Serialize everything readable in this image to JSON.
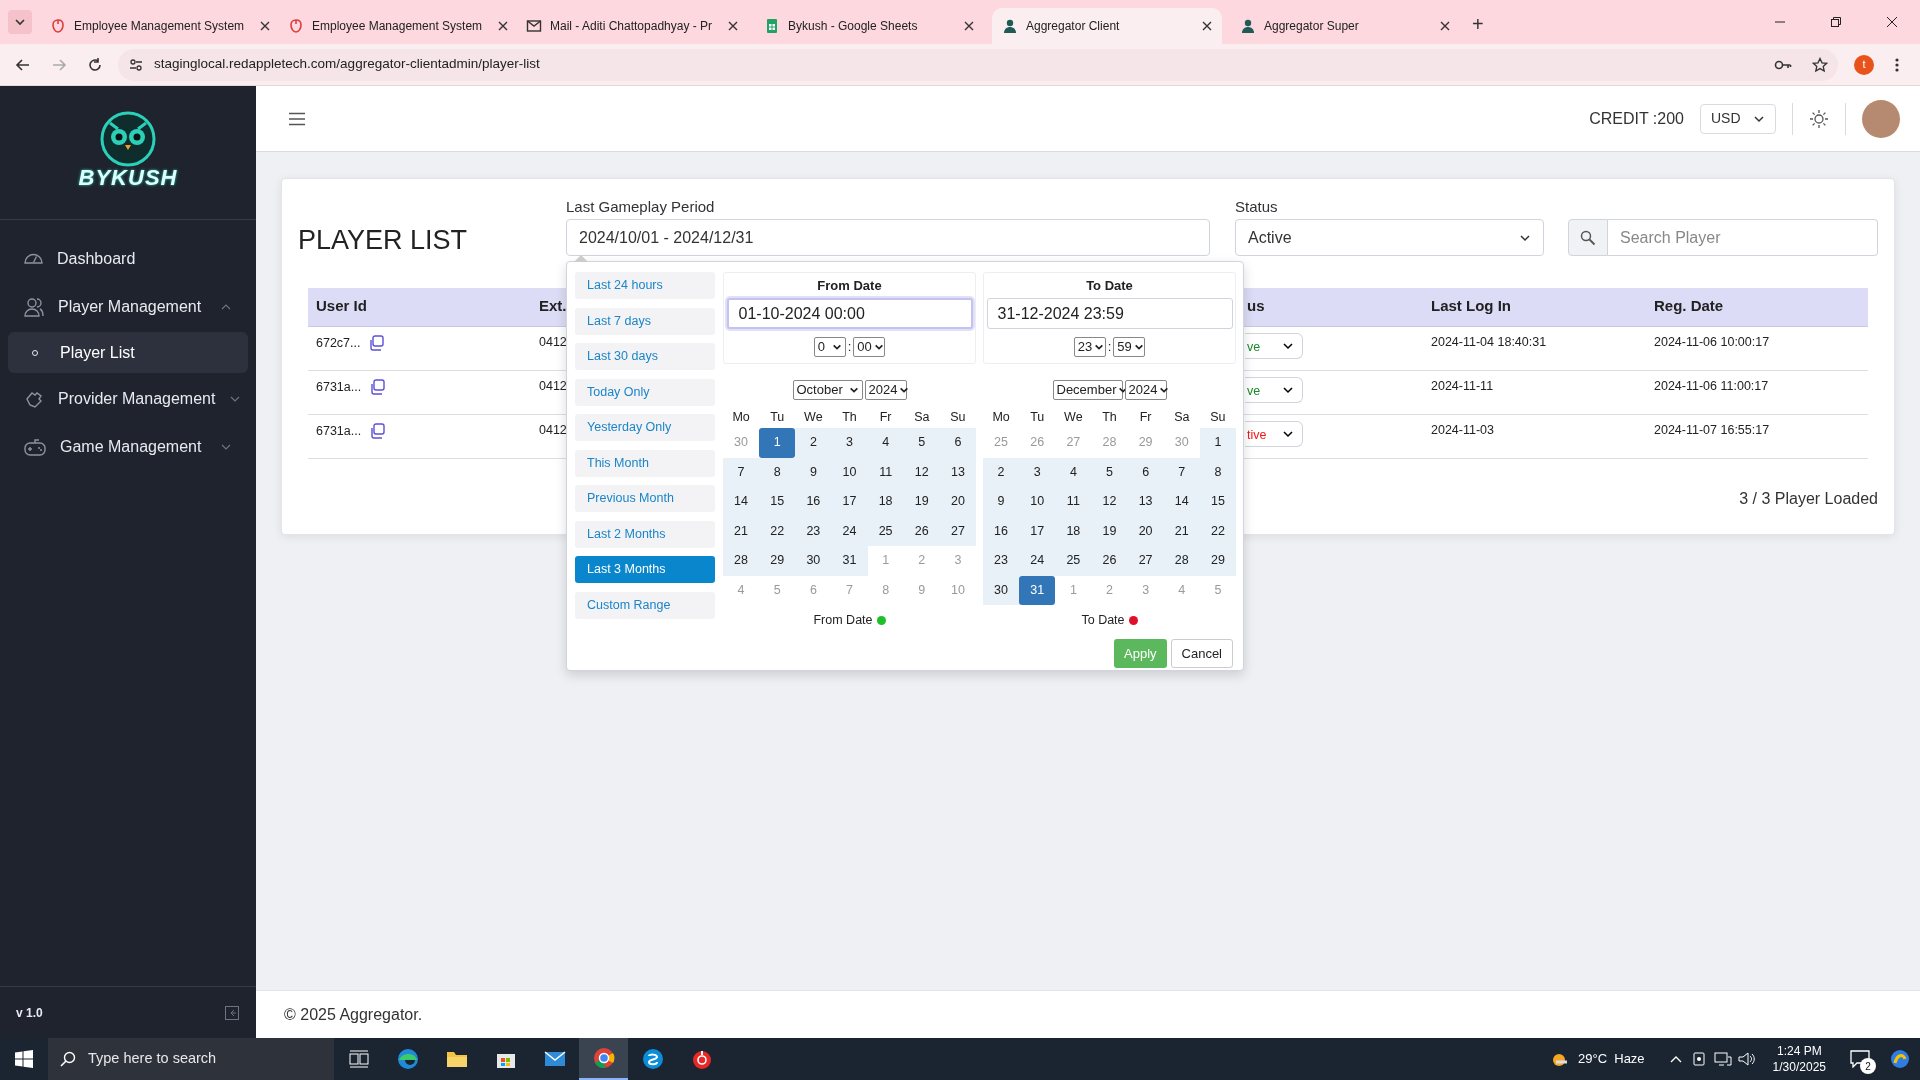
{
  "browser": {
    "tabs": [
      {
        "title": "Employee Management System",
        "selected": false
      },
      {
        "title": "Employee Management System",
        "selected": false
      },
      {
        "title": "Mail - Aditi Chattopadhyay - Pr",
        "selected": false
      },
      {
        "title": "Bykush - Google Sheets",
        "selected": false
      },
      {
        "title": "Aggregator Client",
        "selected": true
      },
      {
        "title": "Aggregator Super",
        "selected": false
      }
    ],
    "new_tab": "+",
    "address": "staginglocal.redappletech.com/aggregator-clientadmin/player-list",
    "profile_initial": "t"
  },
  "sidebar": {
    "logo_text": "BYKUSH",
    "items": [
      {
        "label": "Dashboard",
        "kind": "link"
      },
      {
        "label": "Player Management",
        "kind": "group",
        "expanded": true,
        "children": [
          {
            "label": "Player List",
            "selected": true
          }
        ]
      },
      {
        "label": "Provider Management",
        "kind": "group",
        "expanded": false
      },
      {
        "label": "Game Management",
        "kind": "group",
        "expanded": false
      }
    ],
    "version": "v 1.0"
  },
  "header": {
    "credit": "CREDIT :200",
    "currency": "USD"
  },
  "page": {
    "title": "PLAYER LIST",
    "period": {
      "label": "Last Gameplay Period",
      "value": "2024/10/01 - 2024/12/31"
    },
    "status": {
      "label": "Status",
      "value": "Active"
    },
    "search": {
      "placeholder": "Search Player"
    },
    "table": {
      "columns": [
        "User Id",
        "Ext.",
        "us",
        "Last Log In",
        "Reg. Date"
      ],
      "rows": [
        {
          "user_id": "672c7...",
          "ext": "0412",
          "status": "ve",
          "color": "#1e8a2e",
          "last_login": "2024-11-04 18:40:31",
          "reg_date": "2024-11-06 10:00:17"
        },
        {
          "user_id": "6731a...",
          "ext": "0412",
          "status": "ve",
          "color": "#1e8a2e",
          "last_login": "2024-11-11",
          "reg_date": "2024-11-06 11:00:17"
        },
        {
          "user_id": "6731a...",
          "ext": "0412",
          "status": "tive",
          "color": "#f01818",
          "last_login": "2024-11-03",
          "reg_date": "2024-11-07 16:55:17"
        }
      ]
    },
    "loaded": "3 / 3 Player Loaded"
  },
  "date_picker": {
    "ranges": [
      {
        "label": "Last 24 hours",
        "selected": false
      },
      {
        "label": "Last 7 days",
        "selected": false
      },
      {
        "label": "Last 30 days",
        "selected": false
      },
      {
        "label": "Today Only",
        "selected": false
      },
      {
        "label": "Yesterday Only",
        "selected": false
      },
      {
        "label": "This Month",
        "selected": false
      },
      {
        "label": "Previous Month",
        "selected": false
      },
      {
        "label": "Last 2 Months",
        "selected": false
      },
      {
        "label": "Last 3 Months",
        "selected": true
      },
      {
        "label": "Custom Range",
        "selected": false
      }
    ],
    "calendars": [
      {
        "title": "From Date",
        "value": "01-10-2024 00:00",
        "focused": true,
        "hour": "0",
        "time_separator": ":",
        "minute": "00",
        "month": "October",
        "year": "2024",
        "legend": "From Date",
        "color": "#1fbf2a",
        "weekdays": [
          "Mo",
          "Tu",
          "We",
          "Th",
          "Fr",
          "Sa",
          "Su"
        ],
        "days": [
          {
            "d": "30",
            "kind": "other"
          },
          {
            "d": "1",
            "kind": "selected"
          },
          {
            "d": "2",
            "kind": "range"
          },
          {
            "d": "3",
            "kind": "range"
          },
          {
            "d": "4",
            "kind": "range"
          },
          {
            "d": "5",
            "kind": "range"
          },
          {
            "d": "6",
            "kind": "range"
          },
          {
            "d": "7",
            "kind": "range"
          },
          {
            "d": "8",
            "kind": "range"
          },
          {
            "d": "9",
            "kind": "range"
          },
          {
            "d": "10",
            "kind": "range"
          },
          {
            "d": "11",
            "kind": "range"
          },
          {
            "d": "12",
            "kind": "range"
          },
          {
            "d": "13",
            "kind": "range"
          },
          {
            "d": "14",
            "kind": "range"
          },
          {
            "d": "15",
            "kind": "range"
          },
          {
            "d": "16",
            "kind": "range"
          },
          {
            "d": "17",
            "kind": "range"
          },
          {
            "d": "18",
            "kind": "range"
          },
          {
            "d": "19",
            "kind": "range"
          },
          {
            "d": "20",
            "kind": "range"
          },
          {
            "d": "21",
            "kind": "range"
          },
          {
            "d": "22",
            "kind": "range"
          },
          {
            "d": "23",
            "kind": "range"
          },
          {
            "d": "24",
            "kind": "range"
          },
          {
            "d": "25",
            "kind": "range"
          },
          {
            "d": "26",
            "kind": "range"
          },
          {
            "d": "27",
            "kind": "range"
          },
          {
            "d": "28",
            "kind": "range"
          },
          {
            "d": "29",
            "kind": "range"
          },
          {
            "d": "30",
            "kind": "range"
          },
          {
            "d": "31",
            "kind": "range"
          },
          {
            "d": "1",
            "kind": "other"
          },
          {
            "d": "2",
            "kind": "other"
          },
          {
            "d": "3",
            "kind": "other"
          },
          {
            "d": "4",
            "kind": "other"
          },
          {
            "d": "5",
            "kind": "other"
          },
          {
            "d": "6",
            "kind": "other"
          },
          {
            "d": "7",
            "kind": "other"
          },
          {
            "d": "8",
            "kind": "other"
          },
          {
            "d": "9",
            "kind": "other"
          },
          {
            "d": "10",
            "kind": "other"
          }
        ]
      },
      {
        "title": "To Date",
        "value": "31-12-2024 23:59",
        "focused": false,
        "hour": "23",
        "time_separator": ":",
        "minute": "59",
        "month": "December",
        "year": "2024",
        "legend": "To Date",
        "color": "#e0102a",
        "weekdays": [
          "Mo",
          "Tu",
          "We",
          "Th",
          "Fr",
          "Sa",
          "Su"
        ],
        "days": [
          {
            "d": "25",
            "kind": "other"
          },
          {
            "d": "26",
            "kind": "other"
          },
          {
            "d": "27",
            "kind": "other"
          },
          {
            "d": "28",
            "kind": "other"
          },
          {
            "d": "29",
            "kind": "other"
          },
          {
            "d": "30",
            "kind": "other"
          },
          {
            "d": "1",
            "kind": "range"
          },
          {
            "d": "2",
            "kind": "range"
          },
          {
            "d": "3",
            "kind": "range"
          },
          {
            "d": "4",
            "kind": "range"
          },
          {
            "d": "5",
            "kind": "range"
          },
          {
            "d": "6",
            "kind": "range"
          },
          {
            "d": "7",
            "kind": "range"
          },
          {
            "d": "8",
            "kind": "range"
          },
          {
            "d": "9",
            "kind": "range"
          },
          {
            "d": "10",
            "kind": "range"
          },
          {
            "d": "11",
            "kind": "range"
          },
          {
            "d": "12",
            "kind": "range"
          },
          {
            "d": "13",
            "kind": "range"
          },
          {
            "d": "14",
            "kind": "range"
          },
          {
            "d": "15",
            "kind": "range"
          },
          {
            "d": "16",
            "kind": "range"
          },
          {
            "d": "17",
            "kind": "range"
          },
          {
            "d": "18",
            "kind": "range"
          },
          {
            "d": "19",
            "kind": "range"
          },
          {
            "d": "20",
            "kind": "range"
          },
          {
            "d": "21",
            "kind": "range"
          },
          {
            "d": "22",
            "kind": "range"
          },
          {
            "d": "23",
            "kind": "range"
          },
          {
            "d": "24",
            "kind": "range"
          },
          {
            "d": "25",
            "kind": "range"
          },
          {
            "d": "26",
            "kind": "range"
          },
          {
            "d": "27",
            "kind": "range"
          },
          {
            "d": "28",
            "kind": "range"
          },
          {
            "d": "29",
            "kind": "range"
          },
          {
            "d": "30",
            "kind": "range"
          },
          {
            "d": "31",
            "kind": "selected"
          },
          {
            "d": "1",
            "kind": "other"
          },
          {
            "d": "2",
            "kind": "other"
          },
          {
            "d": "3",
            "kind": "other"
          },
          {
            "d": "4",
            "kind": "other"
          },
          {
            "d": "5",
            "kind": "other"
          }
        ]
      }
    ],
    "apply": "Apply",
    "cancel": "Cancel"
  },
  "footer": "© 2025 Aggregator.",
  "taskbar": {
    "search_placeholder": "Type here to search",
    "weather": "29°C  Haze",
    "time": "1:24 PM",
    "date": "1/30/2025",
    "notifications": "2"
  }
}
